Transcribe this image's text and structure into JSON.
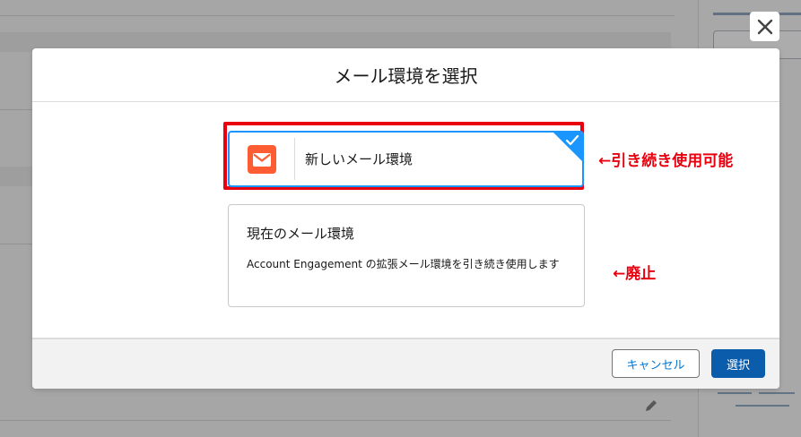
{
  "modal": {
    "title": "メール環境を選択",
    "options": [
      {
        "label": "新しいメール環境",
        "icon": "email-icon",
        "selected": true
      },
      {
        "label": "現在のメール環境",
        "description": "Account Engagement の拡張メール環境を引き続き使用します",
        "selected": false
      }
    ],
    "buttons": {
      "cancel": "キャンセル",
      "select": "選択"
    }
  },
  "annotations": {
    "new_option_note": "←引き続き使用可能",
    "current_option_note": "←廃止"
  },
  "colors": {
    "selection_blue": "#1b96ff",
    "brand_button": "#0b5cab",
    "email_icon_bg": "#fe5c32",
    "annotation_red": "#e8000f"
  }
}
